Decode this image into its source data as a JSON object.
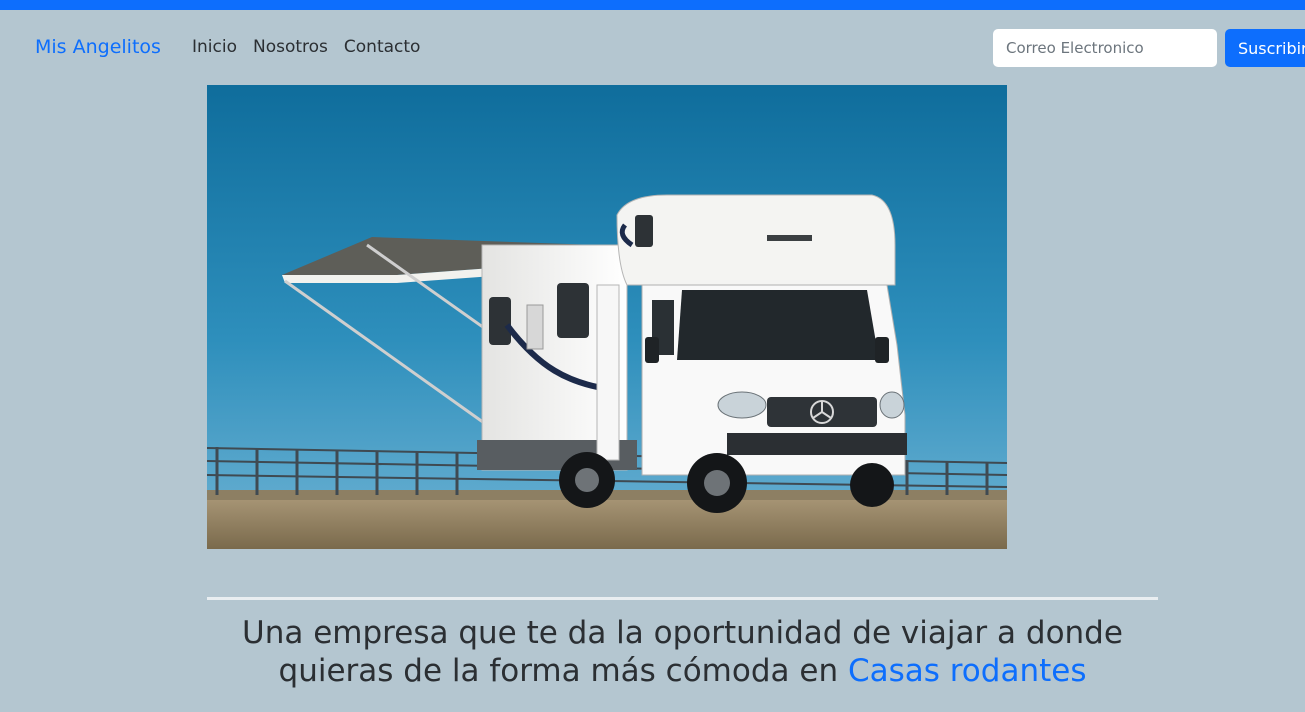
{
  "header": {
    "brand": "Mis Angelitos",
    "nav": [
      {
        "label": "Inicio"
      },
      {
        "label": "Nosotros"
      },
      {
        "label": "Contacto"
      }
    ],
    "email_placeholder": "Correo Electronico",
    "subscribe_label": "Suscribirse"
  },
  "hero": {
    "vehicle_logo": "Mercedes-Benz"
  },
  "main": {
    "tagline_text": "Una empresa que te da la oportunidad de viajar a donde quieras de la forma más cómoda en ",
    "tagline_highlight": "Casas rodantes"
  },
  "colors": {
    "accent": "#0d6efd",
    "background": "#b4c6d0",
    "text": "#2b2f33"
  }
}
